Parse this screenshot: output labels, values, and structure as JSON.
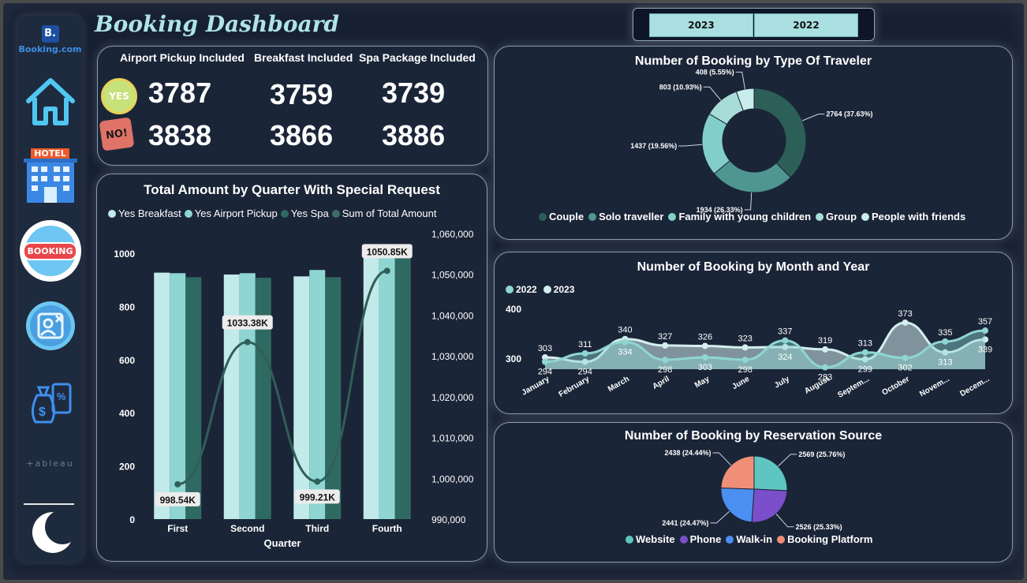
{
  "title": "Booking Dashboard",
  "logo": {
    "mark": "B.",
    "text": "Booking.com"
  },
  "sidebar": {
    "items": [
      {
        "icon": "home-icon"
      },
      {
        "icon": "hotel-icon",
        "label": "HOTEL"
      },
      {
        "icon": "booking-icon",
        "label": "BOOKING"
      },
      {
        "icon": "cancel-user-icon"
      },
      {
        "icon": "money-bag-icon"
      },
      {
        "icon": "tableau-icon",
        "label": "+ableau"
      },
      {
        "icon": "moon-icon"
      }
    ]
  },
  "years": [
    "2023",
    "2022"
  ],
  "kpi": {
    "headers": [
      "Airport Pickup Included",
      "Breakfast Included",
      "Spa Package Included"
    ],
    "yes_label": "YES",
    "no_label": "NO!",
    "yes_values": [
      "3787",
      "3759",
      "3739"
    ],
    "no_values": [
      "3838",
      "3866",
      "3886"
    ]
  },
  "chart_data": [
    {
      "type": "bar",
      "title": "Total Amount by Quarter With Special Request",
      "xlabel": "Quarter",
      "categories": [
        "First",
        "Second",
        "Third",
        "Fourth"
      ],
      "series": [
        {
          "name": "Yes Breakfast",
          "values": [
            927,
            920,
            913,
            1000
          ],
          "color": "#c2eaea"
        },
        {
          "name": "Yes Airport Pickup",
          "values": [
            925,
            925,
            937,
            1000
          ],
          "color": "#8fd6d2"
        },
        {
          "name": "Yes Spa",
          "values": [
            910,
            908,
            910,
            1000
          ],
          "color": "#2f6a62"
        }
      ],
      "line": {
        "name": "Sum of Total Amount",
        "values": [
          998540,
          1033380,
          999210,
          1050850
        ],
        "labels": [
          "998.54K",
          "1033.38K",
          "999.21K",
          "1050.85K"
        ],
        "color": "#2f5f58"
      },
      "ylim": [
        0,
        1000
      ],
      "yticks": [
        "0",
        "200",
        "400",
        "600",
        "800",
        "1000"
      ],
      "y2lim": [
        990000,
        1060000
      ],
      "y2ticks": [
        "990,000",
        "1,000,000",
        "1,010,000",
        "1,020,000",
        "1,030,000",
        "1,040,000",
        "1,050,000",
        "1,060,000"
      ],
      "legend_position": "top"
    },
    {
      "type": "pie",
      "title": "Number of Booking by Type Of Traveler",
      "categories": [
        "Couple",
        "Solo traveller",
        "Family with young children",
        "Group",
        "People with friends"
      ],
      "values": [
        2764,
        1934,
        1437,
        803,
        408
      ],
      "labels": [
        "2764 (37.63%)",
        "1934 (26.33%)",
        "1437 (19.56%)",
        "803 (10.93%)",
        "408 (5.55%)"
      ],
      "colors": [
        "#2c5f58",
        "#4f9690",
        "#82cfca",
        "#a8dcd9",
        "#c9ecec"
      ],
      "donut": true,
      "legend_position": "bottom"
    },
    {
      "type": "area",
      "title": "Number of Booking by Month and Year",
      "x": [
        "January",
        "February",
        "March",
        "April",
        "May",
        "June",
        "July",
        "August",
        "Septem...",
        "October",
        "Novem...",
        "Decem..."
      ],
      "series": [
        {
          "name": "2022",
          "values": [
            294,
            311,
            334,
            298,
            303,
            298,
            337,
            283,
            313,
            302,
            335,
            357
          ],
          "color": "#8fd6d2"
        },
        {
          "name": "2023",
          "values": [
            303,
            294,
            340,
            327,
            326,
            323,
            324,
            319,
            299,
            373,
            313,
            339
          ],
          "color": "#d3eeee"
        }
      ],
      "yticks": [
        "300",
        "400"
      ],
      "legend_position": "top-left"
    },
    {
      "type": "pie",
      "title": "Number of Booking by Reservation Source",
      "categories": [
        "Website",
        "Phone",
        "Walk-in",
        "Booking Platform"
      ],
      "values": [
        2569,
        2526,
        2441,
        2438
      ],
      "labels": [
        "2569 (25.76%)",
        "2526 (25.33%)",
        "2441 (24.47%)",
        "2438 (24.44%)"
      ],
      "colors": [
        "#5ec6c0",
        "#7b4fc9",
        "#4b8ff0",
        "#f08f78"
      ],
      "donut": false,
      "legend_position": "bottom"
    }
  ]
}
